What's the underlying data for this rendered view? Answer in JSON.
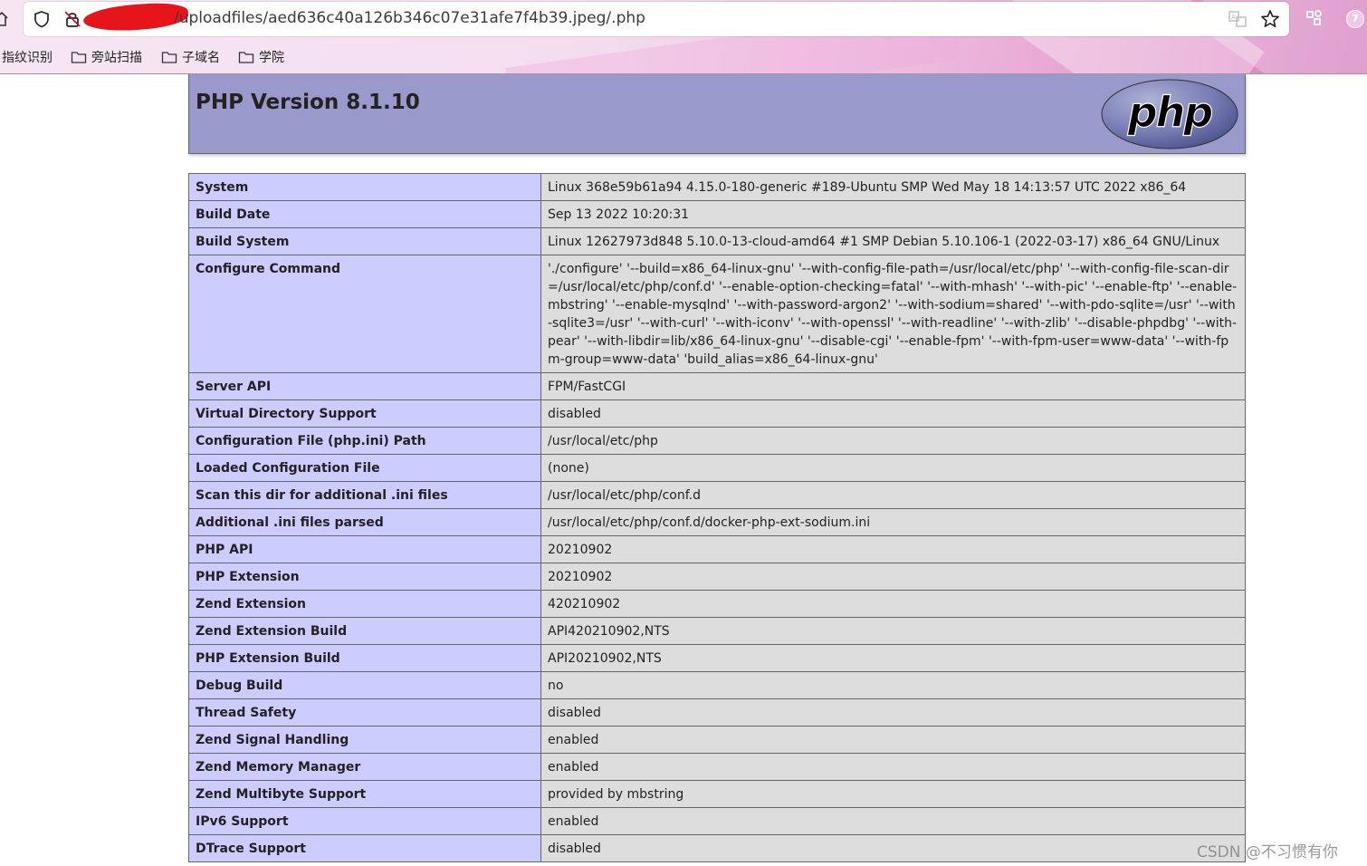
{
  "browser": {
    "url": "/uploadfiles/aed636c40a126b346c07e31afe7f4b39.jpeg/.php",
    "bookmarks": [
      {
        "label": "指纹识别",
        "icon": "none"
      },
      {
        "label": "旁站扫描",
        "icon": "folder-icon"
      },
      {
        "label": "子域名",
        "icon": "folder-icon"
      },
      {
        "label": "学院",
        "icon": "folder-icon"
      }
    ],
    "badge": "7"
  },
  "php": {
    "version_title": "PHP Version 8.1.10",
    "logo_text": "php",
    "rows": [
      {
        "key": "System",
        "value": "Linux 368e59b61a94 4.15.0-180-generic #189-Ubuntu SMP Wed May 18 14:13:57 UTC 2022 x86_64"
      },
      {
        "key": "Build Date",
        "value": "Sep 13 2022 10:20:31"
      },
      {
        "key": "Build System",
        "value": "Linux 12627973d848 5.10.0-13-cloud-amd64 #1 SMP Debian 5.10.106-1 (2022-03-17) x86_64 GNU/Linux"
      },
      {
        "key": "Configure Command",
        "value": "'./configure' '--build=x86_64-linux-gnu' '--with-config-file-path=/usr/local/etc/php' '--with-config-file-scan-dir=/usr/local/etc/php/conf.d' '--enable-option-checking=fatal' '--with-mhash' '--with-pic' '--enable-ftp' '--enable-mbstring' '--enable-mysqlnd' '--with-password-argon2' '--with-sodium=shared' '--with-pdo-sqlite=/usr' '--with-sqlite3=/usr' '--with-curl' '--with-iconv' '--with-openssl' '--with-readline' '--with-zlib' '--disable-phpdbg' '--with-pear' '--with-libdir=lib/x86_64-linux-gnu' '--disable-cgi' '--enable-fpm' '--with-fpm-user=www-data' '--with-fpm-group=www-data' 'build_alias=x86_64-linux-gnu'"
      },
      {
        "key": "Server API",
        "value": "FPM/FastCGI"
      },
      {
        "key": "Virtual Directory Support",
        "value": "disabled"
      },
      {
        "key": "Configuration File (php.ini) Path",
        "value": "/usr/local/etc/php"
      },
      {
        "key": "Loaded Configuration File",
        "value": "(none)"
      },
      {
        "key": "Scan this dir for additional .ini files",
        "value": "/usr/local/etc/php/conf.d"
      },
      {
        "key": "Additional .ini files parsed",
        "value": "/usr/local/etc/php/conf.d/docker-php-ext-sodium.ini"
      },
      {
        "key": "PHP API",
        "value": "20210902"
      },
      {
        "key": "PHP Extension",
        "value": "20210902"
      },
      {
        "key": "Zend Extension",
        "value": "420210902"
      },
      {
        "key": "Zend Extension Build",
        "value": "API420210902,NTS"
      },
      {
        "key": "PHP Extension Build",
        "value": "API20210902,NTS"
      },
      {
        "key": "Debug Build",
        "value": "no"
      },
      {
        "key": "Thread Safety",
        "value": "disabled"
      },
      {
        "key": "Zend Signal Handling",
        "value": "enabled"
      },
      {
        "key": "Zend Memory Manager",
        "value": "enabled"
      },
      {
        "key": "Zend Multibyte Support",
        "value": "provided by mbstring"
      },
      {
        "key": "IPv6 Support",
        "value": "enabled"
      },
      {
        "key": "DTrace Support",
        "value": "disabled"
      }
    ]
  },
  "watermark": "CSDN @不习惯有你",
  "colors": {
    "header_bg": "#9999cc",
    "key_bg": "#ccccff",
    "value_bg": "#dddddd",
    "border": "#666666"
  }
}
